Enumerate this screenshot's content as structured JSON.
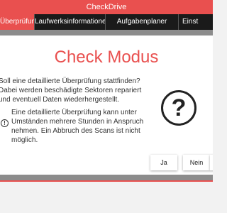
{
  "app": {
    "title": "CheckDrive"
  },
  "tabs": [
    {
      "label": "Überprüfung",
      "active": true
    },
    {
      "label": "Laufwerksinformationen",
      "active": false
    },
    {
      "label": "Aufgabenplaner",
      "active": false
    },
    {
      "label": "Einst",
      "active": false
    }
  ],
  "dialog": {
    "title": "Check Modus",
    "message": "Soll eine detaillierte Überprüfung stattfinden? Dabei werden beschädigte Sektoren repariert und eventuell Daten wiederhergestellt.",
    "warning": "Eine detaillierte Überprüfung kann unter Umständen mehrere Stunden in Anspruch nehmen. Ein Abbruch des Scans ist nicht möglich.",
    "warning_icon": "exclamation-circle-icon",
    "question_icon": "question-mark-circle-icon",
    "question_glyph": "?",
    "warning_glyph": "!",
    "yes_label": "Ja",
    "no_label": "Nein"
  },
  "colors": {
    "accent": "#e9504f",
    "tabbar": "#1a1a1a",
    "overlay": "#8c8c8c"
  }
}
